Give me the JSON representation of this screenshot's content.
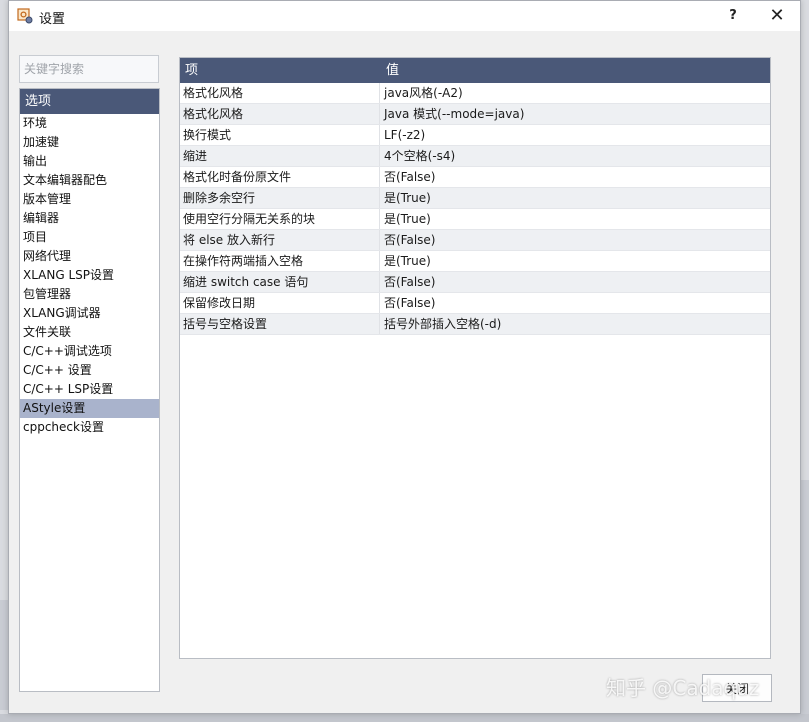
{
  "window": {
    "title": "设置",
    "help_label": "?",
    "close_label": "✕"
  },
  "search": {
    "placeholder": "关键字搜索"
  },
  "sidebar": {
    "header": "选项",
    "items": [
      {
        "label": "环境",
        "selected": false
      },
      {
        "label": "加速键",
        "selected": false
      },
      {
        "label": "输出",
        "selected": false
      },
      {
        "label": "文本编辑器配色",
        "selected": false
      },
      {
        "label": "版本管理",
        "selected": false
      },
      {
        "label": "编辑器",
        "selected": false
      },
      {
        "label": "项目",
        "selected": false
      },
      {
        "label": "网络代理",
        "selected": false
      },
      {
        "label": "XLANG LSP设置",
        "selected": false
      },
      {
        "label": "包管理器",
        "selected": false
      },
      {
        "label": "XLANG调试器",
        "selected": false
      },
      {
        "label": "文件关联",
        "selected": false
      },
      {
        "label": "C/C++调试选项",
        "selected": false
      },
      {
        "label": "C/C++ 设置",
        "selected": false
      },
      {
        "label": "C/C++ LSP设置",
        "selected": false
      },
      {
        "label": "AStyle设置",
        "selected": true
      },
      {
        "label": "cppcheck设置",
        "selected": false
      }
    ]
  },
  "grid": {
    "columns": [
      "项",
      "值"
    ],
    "rows": [
      {
        "key": "格式化风格",
        "value": "java风格(-A2)"
      },
      {
        "key": "格式化风格",
        "value": "Java 模式(--mode=java)"
      },
      {
        "key": "换行模式",
        "value": "LF(-z2)"
      },
      {
        "key": "缩进",
        "value": "4个空格(-s4)"
      },
      {
        "key": "格式化时备份原文件",
        "value": "否(False)"
      },
      {
        "key": "删除多余空行",
        "value": "是(True)"
      },
      {
        "key": "使用空行分隔无关系的块",
        "value": "是(True)"
      },
      {
        "key": "将 else 放入新行",
        "value": "否(False)"
      },
      {
        "key": "在操作符两端插入空格",
        "value": "是(True)"
      },
      {
        "key": "缩进 switch case 语句",
        "value": "否(False)"
      },
      {
        "key": "保留修改日期",
        "value": "否(False)"
      },
      {
        "key": "括号与空格设置",
        "value": "括号外部插入空格(-d)"
      }
    ]
  },
  "footer": {
    "close_button": "关闭"
  },
  "watermark": "知乎 @Cadaquz",
  "colors": {
    "header_bg": "#4a5878",
    "selected_bg": "#a9b3cc"
  }
}
